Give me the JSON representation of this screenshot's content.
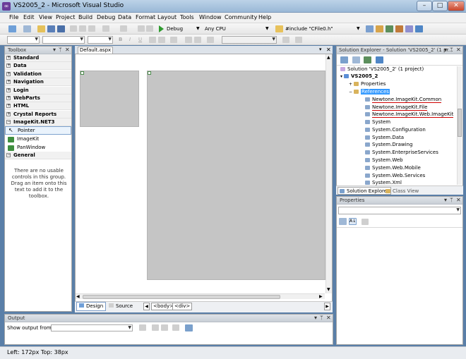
{
  "window": {
    "title": "VS2005_2 - Microsoft Visual Studio",
    "min": "–",
    "max": "□",
    "close": "✕"
  },
  "menu": [
    "File",
    "Edit",
    "View",
    "Project",
    "Build",
    "Debug",
    "Data",
    "Format",
    "Layout",
    "Tools",
    "Window",
    "Community",
    "Help"
  ],
  "toolbar": {
    "config": "Debug",
    "platform": "Any CPU",
    "find": "#include \"CFile0.h\""
  },
  "toolbox": {
    "title": "Toolbox",
    "groups": [
      "Standard",
      "Data",
      "Validation",
      "Navigation",
      "Login",
      "WebParts",
      "HTML",
      "Crystal Reports",
      "ImageKit.NET3"
    ],
    "items": [
      "Pointer",
      "ImageKit",
      "PanWindow"
    ],
    "general": "General",
    "empty_text": "There are no usable controls in this group. Drag an item onto this text to add it to the toolbox."
  },
  "document": {
    "tab": "Default.aspx",
    "views": {
      "design": "Design",
      "source": "Source"
    },
    "breadcrumbs": [
      "<body>",
      "<div>"
    ]
  },
  "output": {
    "title": "Output",
    "show_from": "Show output from:"
  },
  "solution_explorer": {
    "title": "Solution Explorer - Solution 'VS2005_2' (1 pr...",
    "solution": "Solution 'VS2005_2' (1 project)",
    "project": "VS2005_2",
    "properties": "Properties",
    "references": "References",
    "refs": [
      "Newtone.ImageKit.Common",
      "Newtone.ImageKit.File",
      "Newtone.ImageKit.Web.ImageKit",
      "System",
      "System.Configuration",
      "System.Data",
      "System.Drawing",
      "System.EnterpriseServices",
      "System.Web",
      "System.Web.Mobile",
      "System.Web.Services",
      "System.Xml"
    ],
    "tab_solution": "Solution Explorer",
    "tab_class": "Class View"
  },
  "properties": {
    "title": "Properties"
  },
  "status": {
    "text": "Left: 172px  Top: 38px"
  },
  "colors": {
    "accent": "#3399ff",
    "selection": "#3399ff",
    "underline": "#d00000",
    "design_gray": "#c5c5c5"
  }
}
